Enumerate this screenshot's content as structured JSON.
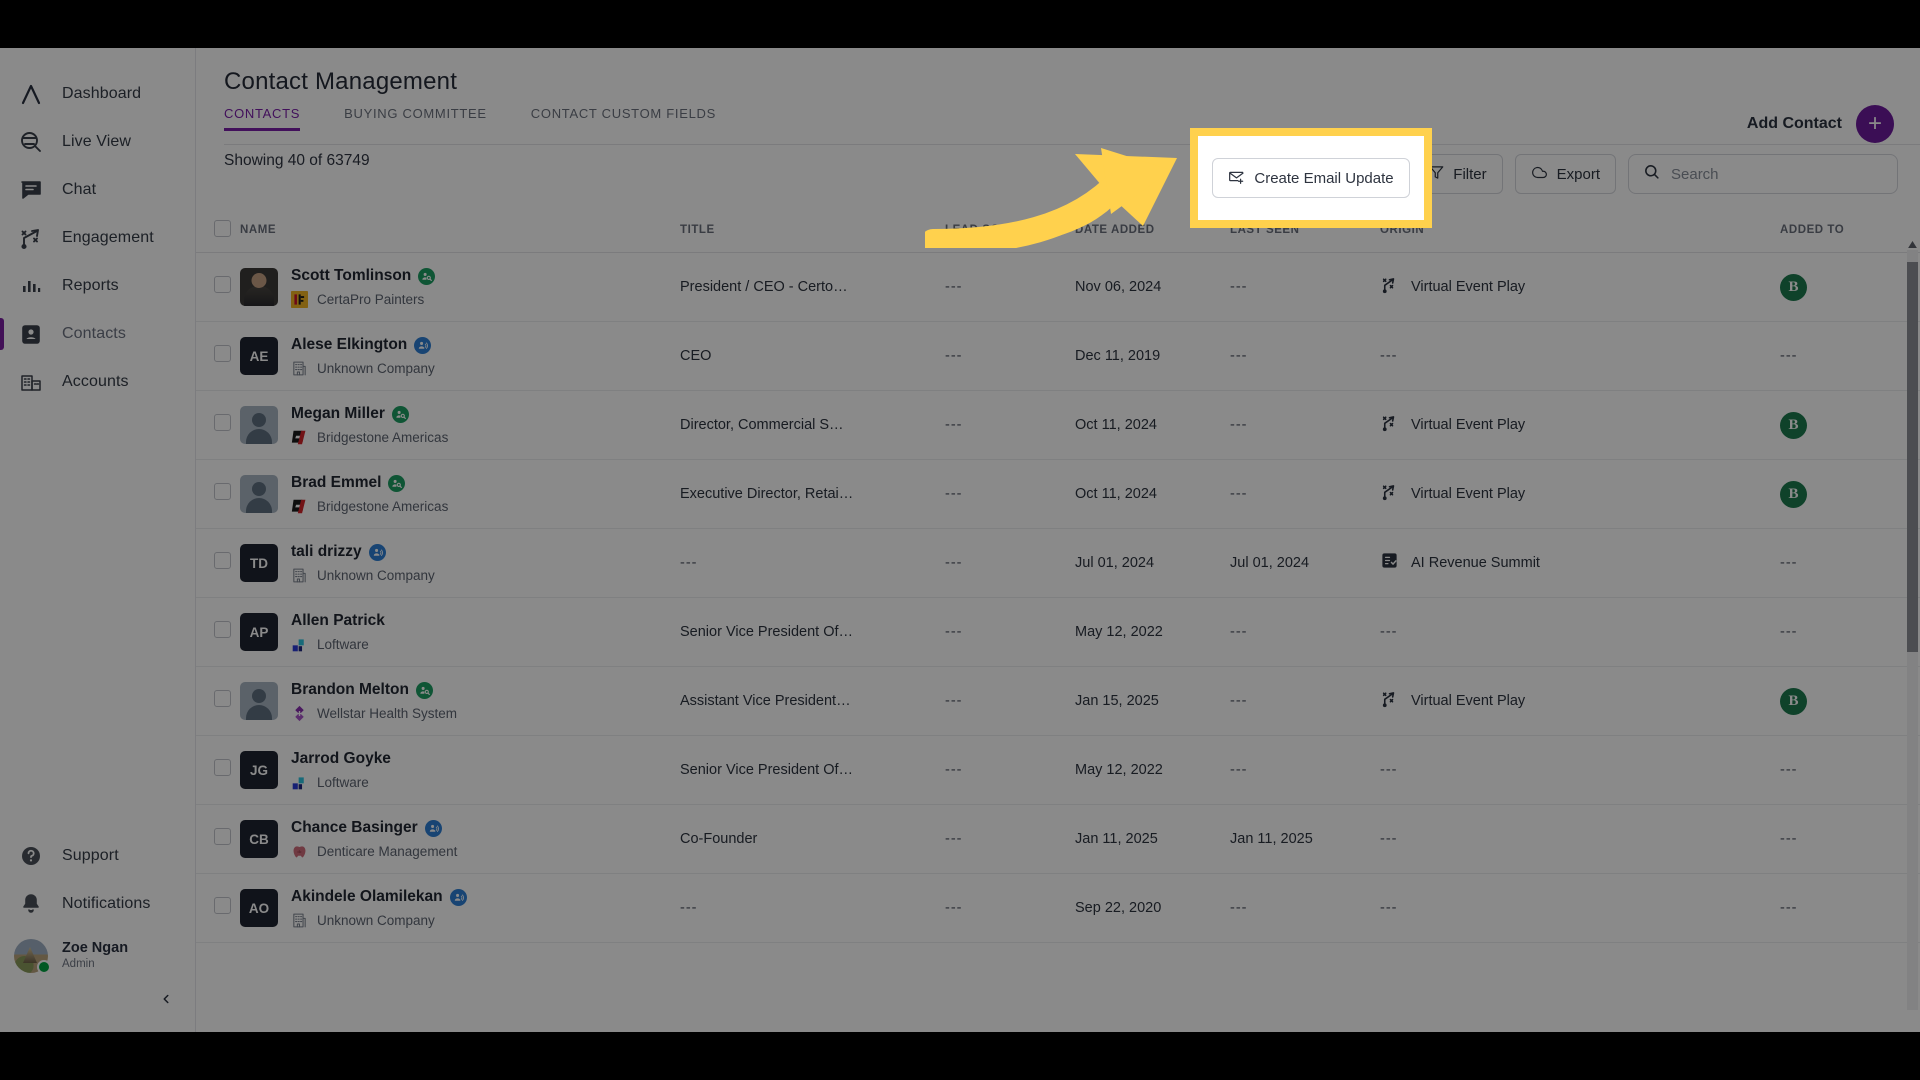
{
  "sidebar": {
    "items": [
      {
        "label": "Dashboard",
        "icon": "logo-a-icon",
        "active": false
      },
      {
        "label": "Live View",
        "icon": "live-view-icon",
        "active": false
      },
      {
        "label": "Chat",
        "icon": "chat-icon",
        "active": false
      },
      {
        "label": "Engagement",
        "icon": "engagement-icon",
        "active": false
      },
      {
        "label": "Reports",
        "icon": "reports-icon",
        "active": false
      },
      {
        "label": "Contacts",
        "icon": "contacts-icon",
        "active": true
      },
      {
        "label": "Accounts",
        "icon": "accounts-icon",
        "active": false
      }
    ],
    "bottom": [
      {
        "label": "Support",
        "icon": "help-circle-icon"
      },
      {
        "label": "Notifications",
        "icon": "bell-icon"
      }
    ],
    "user": {
      "name": "Zoe Ngan",
      "role": "Admin"
    },
    "collapse_icon": "chevron-left-icon"
  },
  "header": {
    "title": "Contact Management",
    "tabs": [
      {
        "label": "CONTACTS",
        "active": true
      },
      {
        "label": "BUYING COMMITTEE",
        "active": false
      },
      {
        "label": "CONTACT CUSTOM FIELDS",
        "active": false
      }
    ],
    "add_contact_label": "Add Contact",
    "add_contact_icon": "plus-icon",
    "accent_color": "#7a1fa8",
    "fab_color": "#6d1b9e"
  },
  "toolbar": {
    "showing_text": "Showing 40 of  63749",
    "create_email_update_label": "Create Email Update",
    "create_email_update_icon": "mail-plus-icon",
    "filter_label": "Filter",
    "filter_icon": "funnel-icon",
    "export_label": "Export",
    "export_icon": "cloud-download-icon",
    "search_placeholder": "Search",
    "search_value": "",
    "search_icon": "search-icon"
  },
  "highlight": {
    "color": "#ffd14d",
    "target": "Create Email Update",
    "annotation_icon": "curved-arrow-icon"
  },
  "table": {
    "columns": [
      {
        "key": "checkbox",
        "label": ""
      },
      {
        "key": "name",
        "label": "NAME"
      },
      {
        "key": "title",
        "label": "TITLE"
      },
      {
        "key": "score",
        "label": "LEAD SCORE",
        "sort": "↑"
      },
      {
        "key": "date",
        "label": "DATE ADDED"
      },
      {
        "key": "seen",
        "label": "LAST SEEN"
      },
      {
        "key": "origin",
        "label": "ORIGIN"
      },
      {
        "key": "added",
        "label": "ADDED TO"
      }
    ],
    "rows": [
      {
        "name": "Scott Tomlinson",
        "badge": "green",
        "avatar": "photo",
        "initials": "",
        "company": "CertaPro Painters",
        "logo": "certapro",
        "title": "President / CEO - Certo…",
        "score": "---",
        "date": "Nov 06, 2024",
        "seen": "---",
        "origin": "Virtual Event Play",
        "origin_icon": "play-icon",
        "added": "B"
      },
      {
        "name": "Alese Elkington",
        "badge": "blue",
        "avatar": "initials",
        "initials": "AE",
        "company": "Unknown Company",
        "logo": "building",
        "title": "CEO",
        "score": "---",
        "date": "Dec 11, 2019",
        "seen": "---",
        "origin": "---",
        "origin_icon": "",
        "added": "---"
      },
      {
        "name": "Megan Miller",
        "badge": "green",
        "avatar": "silhouette",
        "initials": "",
        "company": "Bridgestone Americas",
        "logo": "bridgestone",
        "title": "Director, Commercial S…",
        "score": "---",
        "date": "Oct 11, 2024",
        "seen": "---",
        "origin": "Virtual Event Play",
        "origin_icon": "play-icon",
        "added": "B"
      },
      {
        "name": "Brad Emmel",
        "badge": "green",
        "avatar": "silhouette",
        "initials": "",
        "company": "Bridgestone Americas",
        "logo": "bridgestone",
        "title": "Executive Director, Retai…",
        "score": "---",
        "date": "Oct 11, 2024",
        "seen": "---",
        "origin": "Virtual Event Play",
        "origin_icon": "play-icon",
        "added": "B"
      },
      {
        "name": "tali drizzy",
        "badge": "blue",
        "avatar": "initials",
        "initials": "TD",
        "company": "Unknown Company",
        "logo": "building",
        "title": "---",
        "score": "---",
        "date": "Jul 01, 2024",
        "seen": "Jul 01, 2024",
        "origin": "AI Revenue Summit",
        "origin_icon": "form-icon",
        "added": "---"
      },
      {
        "name": "Allen Patrick",
        "badge": "",
        "avatar": "initials",
        "initials": "AP",
        "company": "Loftware",
        "logo": "loftware",
        "title": "Senior Vice President Of…",
        "score": "---",
        "date": "May 12, 2022",
        "seen": "---",
        "origin": "---",
        "origin_icon": "",
        "added": "---"
      },
      {
        "name": "Brandon Melton",
        "badge": "green",
        "avatar": "silhouette",
        "initials": "",
        "company": "Wellstar Health System",
        "logo": "wellstar",
        "title": "Assistant Vice President…",
        "score": "---",
        "date": "Jan 15, 2025",
        "seen": "---",
        "origin": "Virtual Event Play",
        "origin_icon": "play-icon",
        "added": "B"
      },
      {
        "name": "Jarrod Goyke",
        "badge": "",
        "avatar": "initials",
        "initials": "JG",
        "company": "Loftware",
        "logo": "loftware",
        "title": "Senior Vice President Of…",
        "score": "---",
        "date": "May 12, 2022",
        "seen": "---",
        "origin": "---",
        "origin_icon": "",
        "added": "---"
      },
      {
        "name": "Chance Basinger",
        "badge": "blue",
        "avatar": "initials",
        "initials": "CB",
        "company": "Denticare Management",
        "logo": "denticare",
        "title": "Co-Founder",
        "score": "---",
        "date": "Jan 11, 2025",
        "seen": "Jan 11, 2025",
        "origin": "---",
        "origin_icon": "",
        "added": "---"
      },
      {
        "name": "Akindele Olamilekan",
        "badge": "blue",
        "avatar": "initials",
        "initials": "AO",
        "company": "Unknown Company",
        "logo": "building",
        "title": "---",
        "score": "---",
        "date": "Sep 22, 2020",
        "seen": "---",
        "origin": "---",
        "origin_icon": "",
        "added": "---"
      }
    ]
  }
}
